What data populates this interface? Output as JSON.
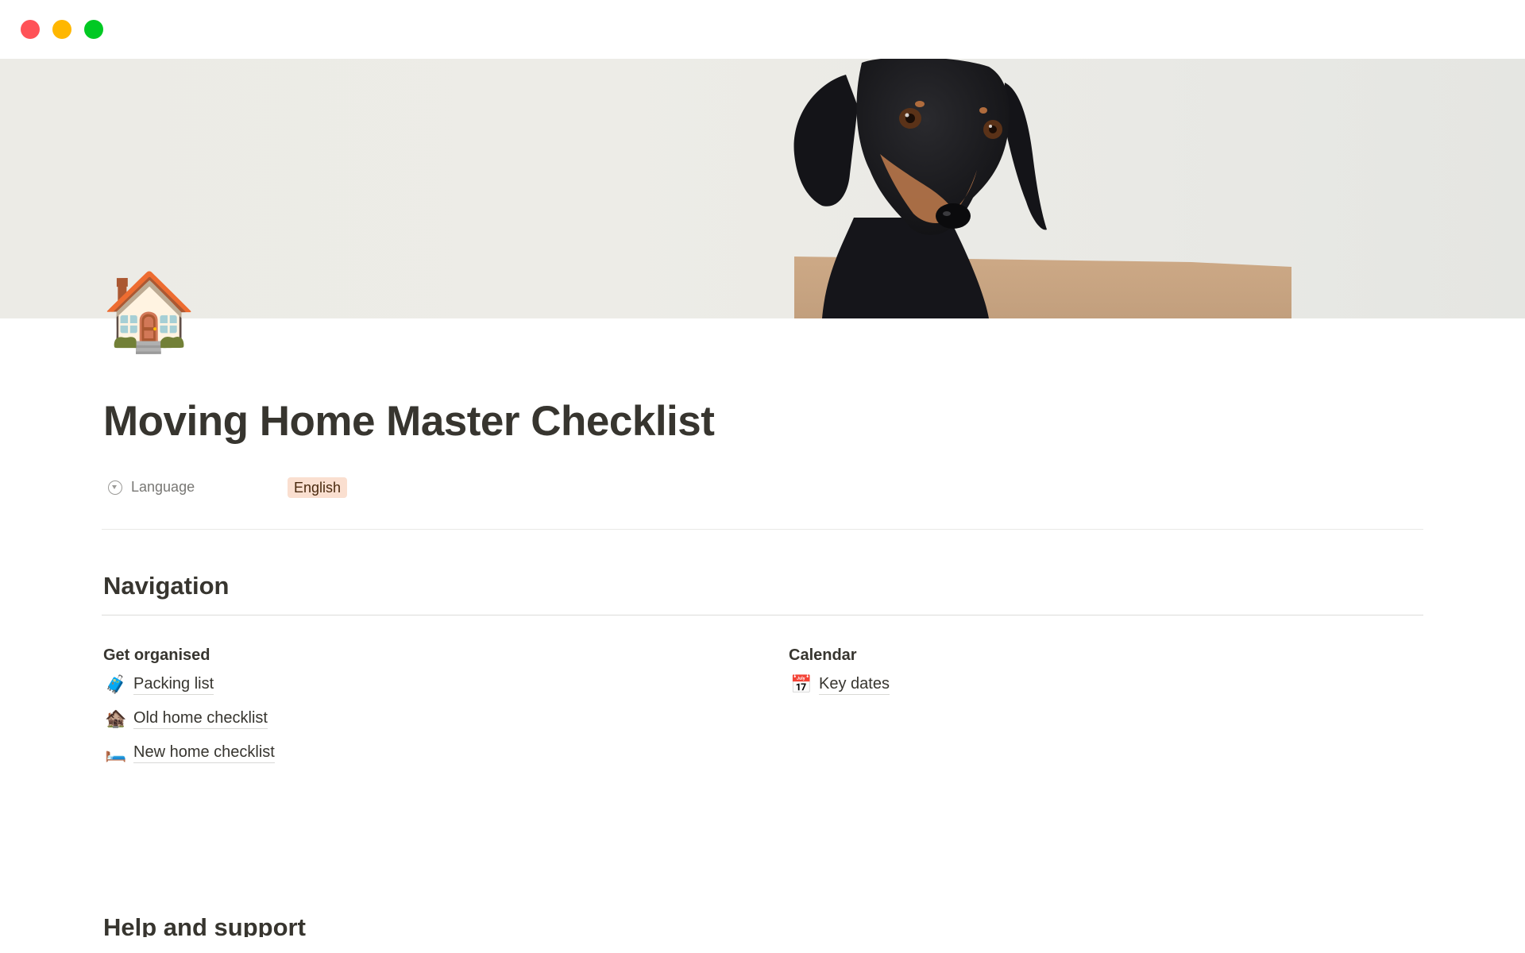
{
  "window": {
    "controls": [
      "close",
      "minimize",
      "maximize"
    ],
    "colors": {
      "close": "#ff5257",
      "minimize": "#ffb700",
      "maximize": "#00c923"
    }
  },
  "cover": {
    "description": "Black and tan dachshund peeking over a cardboard box against a light wall"
  },
  "page": {
    "icon": "🏠",
    "icon_name": "house-icon",
    "title": "Moving Home Master Checklist",
    "properties": [
      {
        "icon": "select-property-icon",
        "label": "Language",
        "value": "English",
        "badge_color": "#fadfd0"
      }
    ]
  },
  "sections": {
    "navigation": {
      "heading": "Navigation",
      "columns": [
        {
          "title": "Get organised",
          "links": [
            {
              "emoji": "🧳",
              "icon_name": "luggage-icon",
              "label": "Packing list"
            },
            {
              "emoji": "🏚️",
              "icon_name": "old-house-icon",
              "label": "Old home checklist"
            },
            {
              "emoji": "🛏️",
              "icon_name": "bed-icon",
              "label": "New home checklist"
            }
          ]
        },
        {
          "title": "Calendar",
          "links": [
            {
              "emoji": "📅",
              "icon_name": "calendar-icon",
              "label": "Key dates"
            }
          ]
        }
      ]
    },
    "help": {
      "heading": "Help and support"
    }
  }
}
